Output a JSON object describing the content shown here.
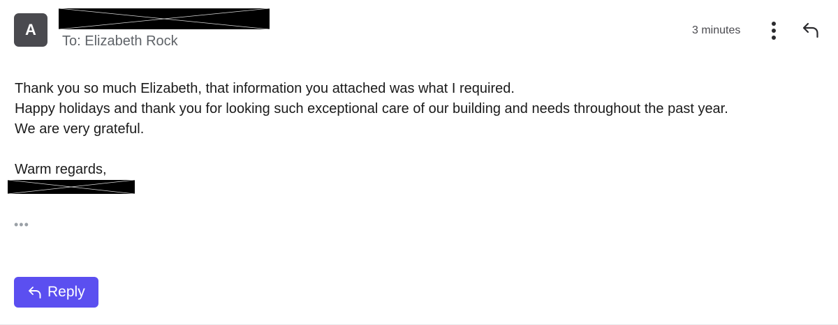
{
  "header": {
    "avatar_letter": "A",
    "recipient": "To: Elizabeth Rock",
    "timestamp": "3 minutes",
    "more_icon": "vertical-ellipsis-icon",
    "reply_icon": "reply-arrow-icon"
  },
  "message": {
    "lines": [
      "Thank you so much Elizabeth, that information you attached was what I required.",
      "Happy holidays and thank you for looking such exceptional care of our building and needs throughout the past year.",
      "We are very grateful."
    ],
    "closing": "Warm regards,",
    "expand_indicator": "•••"
  },
  "actions": {
    "reply_label": "Reply"
  },
  "colors": {
    "accent": "#5b4ff0",
    "avatar_bg": "#4a4a4f",
    "muted_text": "#5f6368"
  }
}
